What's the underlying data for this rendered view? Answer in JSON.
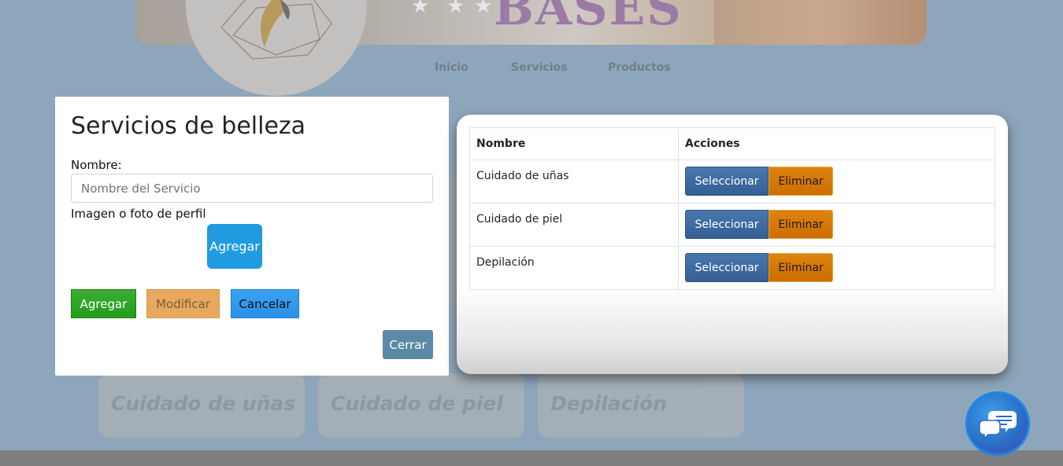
{
  "background": {
    "banner_title": "BASES",
    "nav": [
      "Inicio",
      "Servicios",
      "Productos"
    ],
    "cards": [
      "Cuidado de uñas",
      "Cuidado de piel",
      "Depilación"
    ]
  },
  "modal": {
    "title": "Servicios de belleza",
    "name_label": "Nombre:",
    "name_placeholder": "Nombre del Servicio",
    "name_value": "",
    "image_label": "Imagen o foto de perfil",
    "upload_button": "Agregar",
    "add_button": "Agregar",
    "modify_button": "Modificar",
    "cancel_button": "Cancelar",
    "close_button": "Cerrar"
  },
  "table": {
    "headers": [
      "Nombre",
      "Acciones"
    ],
    "rows": [
      {
        "name": "Cuidado de uñas",
        "select": "Seleccionar",
        "delete": "Eliminar"
      },
      {
        "name": "Cuidado de piel",
        "select": "Seleccionar",
        "delete": "Eliminar"
      },
      {
        "name": "Depilación",
        "select": "Seleccionar",
        "delete": "Eliminar"
      }
    ]
  },
  "chat": {
    "icon": "chat-bubbles-icon"
  },
  "colors": {
    "primary": "#209be0",
    "success": "#239d1b",
    "warning": "#e6a95e",
    "select": "#335f94",
    "delete": "#cc6e00",
    "close": "#5a8aa6"
  }
}
